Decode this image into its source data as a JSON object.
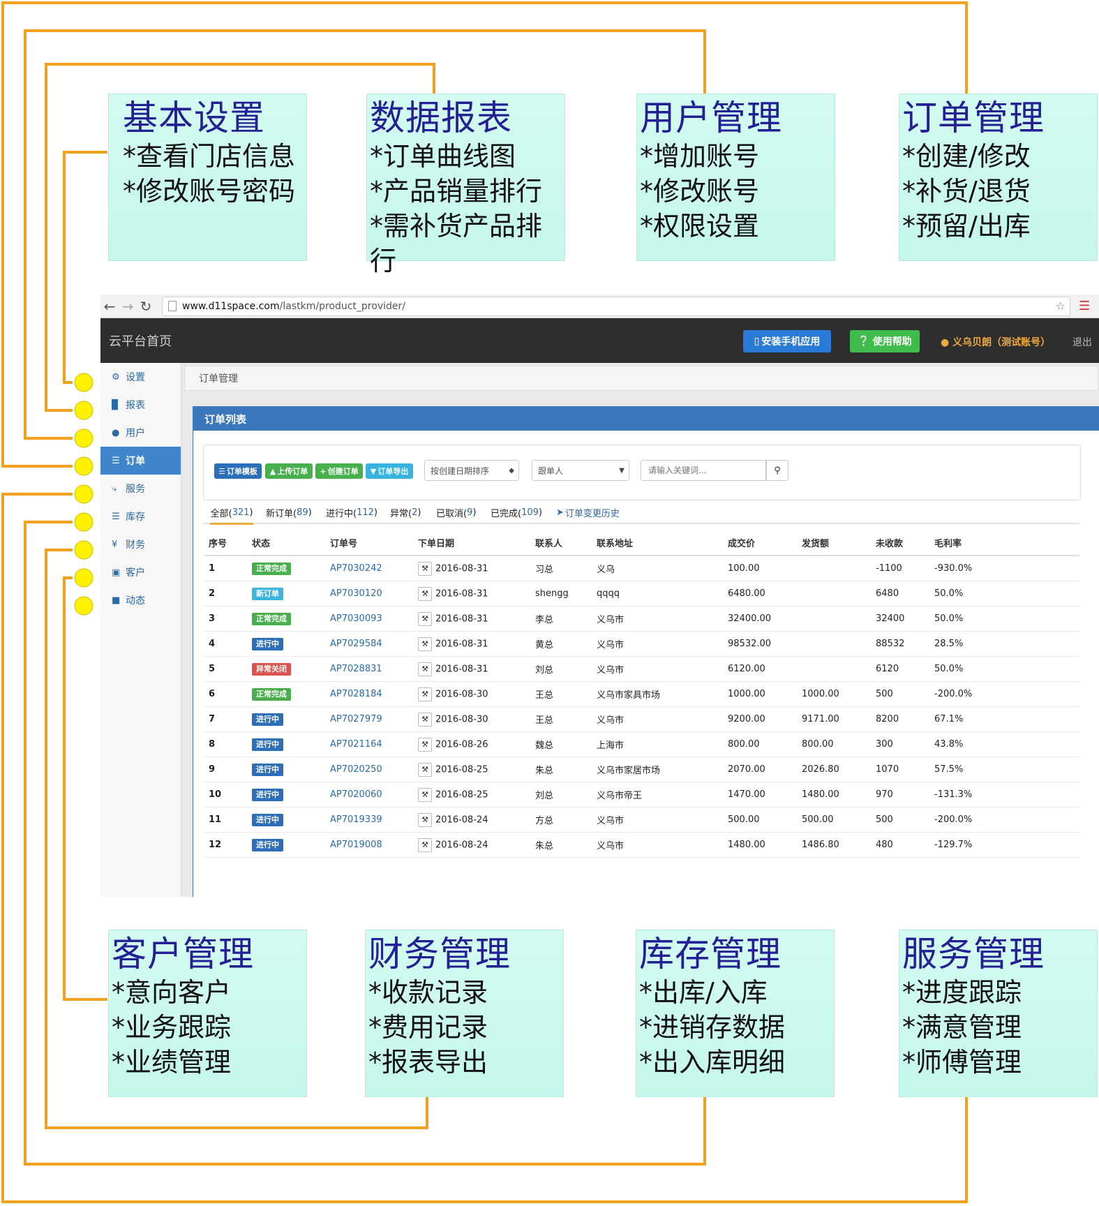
{
  "callouts_top": [
    {
      "title": "基本设置",
      "items": [
        "*查看门店信息",
        "*修改账号密码"
      ]
    },
    {
      "title": "数据报表",
      "items": [
        "*订单曲线图",
        "*产品销量排行",
        "*需补货产品排行"
      ]
    },
    {
      "title": "用户管理",
      "items": [
        "*增加账号",
        "*修改账号",
        "*权限设置"
      ]
    },
    {
      "title": "订单管理",
      "items": [
        "*创建/修改",
        "*补货/退货",
        "*预留/出库"
      ]
    }
  ],
  "callouts_bottom": [
    {
      "title": "客户管理",
      "items": [
        "*意向客户",
        "*业务跟踪",
        "*业绩管理"
      ]
    },
    {
      "title": "财务管理",
      "items": [
        "*收款记录",
        "*费用记录",
        "*报表导出"
      ]
    },
    {
      "title": "库存管理",
      "items": [
        "*出库/入库",
        "*进销存数据",
        "*出入库明细"
      ]
    },
    {
      "title": "服务管理",
      "items": [
        "*进度跟踪",
        "*满意管理",
        "*师傅管理"
      ]
    }
  ],
  "browser": {
    "url_host": "www.d11space.com",
    "url_path": "/lastkm/product_provider/"
  },
  "header": {
    "brand": "云平台首页",
    "install_app": "安装手机应用",
    "help": "使用帮助",
    "user": "义乌贝朗（测试账号）",
    "logout": "退出"
  },
  "sidebar": {
    "items": [
      {
        "label": "设置",
        "icon": "gear-icon"
      },
      {
        "label": "报表",
        "icon": "bar-chart-icon"
      },
      {
        "label": "用户",
        "icon": "user-icon"
      },
      {
        "label": "订单",
        "icon": "list-icon",
        "active": true
      },
      {
        "label": "服务",
        "icon": "wrench-icon"
      },
      {
        "label": "库存",
        "icon": "barcode-icon"
      },
      {
        "label": "财务",
        "icon": "yen-icon"
      },
      {
        "label": "客户",
        "icon": "briefcase-icon"
      },
      {
        "label": "动态",
        "icon": "comment-icon"
      }
    ]
  },
  "breadcrumb": "订单管理",
  "panel_title": "订单列表",
  "toolbar": {
    "template": "订单模板",
    "upload": "上传订单",
    "create": "创建订单",
    "export": "订单导出",
    "sort_select": "按创建日期排序",
    "follower_select": "跟单人",
    "search_placeholder": "请输入关键词..."
  },
  "tabs": [
    {
      "label": "全部(",
      "count": "321",
      "suffix": ")"
    },
    {
      "label": "新订单(",
      "count": "89",
      "suffix": ")"
    },
    {
      "label": "进行中(",
      "count": "112",
      "suffix": ")"
    },
    {
      "label": "异常(",
      "count": "2",
      "suffix": ")"
    },
    {
      "label": "已取消(",
      "count": "9",
      "suffix": ")"
    },
    {
      "label": "已完成(",
      "count": "109",
      "suffix": ")"
    }
  ],
  "history_link": "订单变更历史",
  "table": {
    "headers": [
      "序号",
      "状态",
      "订单号",
      "下单日期",
      "联系人",
      "联系地址",
      "成交价",
      "发货额",
      "未收款",
      "毛利率"
    ],
    "rows": [
      {
        "no": "1",
        "status": "正常完成",
        "status_color": "#47b04c",
        "order": "AP7030242",
        "date": "2016-08-31",
        "contact": "习总",
        "addr": "义乌",
        "price": "100.00",
        "shipped": "",
        "unpaid": "-1100",
        "margin": "-930.0%"
      },
      {
        "no": "2",
        "status": "新订单",
        "status_color": "#3cb6e0",
        "order": "AP7030120",
        "date": "2016-08-31",
        "contact": "shengg",
        "addr": "qqqq",
        "price": "6480.00",
        "shipped": "",
        "unpaid": "6480",
        "margin": "50.0%"
      },
      {
        "no": "3",
        "status": "正常完成",
        "status_color": "#47b04c",
        "order": "AP7030093",
        "date": "2016-08-31",
        "contact": "李总",
        "addr": "义乌市",
        "price": "32400.00",
        "shipped": "",
        "unpaid": "32400",
        "margin": "50.0%"
      },
      {
        "no": "4",
        "status": "进行中",
        "status_color": "#2b6fba",
        "order": "AP7029584",
        "date": "2016-08-31",
        "contact": "黄总",
        "addr": "义乌市",
        "price": "98532.00",
        "shipped": "",
        "unpaid": "88532",
        "margin": "28.5%"
      },
      {
        "no": "5",
        "status": "异常关闭",
        "status_color": "#d9534f",
        "order": "AP7028831",
        "date": "2016-08-31",
        "contact": "刘总",
        "addr": "义乌市",
        "price": "6120.00",
        "shipped": "",
        "unpaid": "6120",
        "margin": "50.0%"
      },
      {
        "no": "6",
        "status": "正常完成",
        "status_color": "#47b04c",
        "order": "AP7028184",
        "date": "2016-08-30",
        "contact": "王总",
        "addr": "义乌市家具市场",
        "price": "1000.00",
        "shipped": "1000.00",
        "unpaid": "500",
        "margin": "-200.0%"
      },
      {
        "no": "7",
        "status": "进行中",
        "status_color": "#2b6fba",
        "order": "AP7027979",
        "date": "2016-08-30",
        "contact": "王总",
        "addr": "义乌市",
        "price": "9200.00",
        "shipped": "9171.00",
        "unpaid": "8200",
        "margin": "67.1%"
      },
      {
        "no": "8",
        "status": "进行中",
        "status_color": "#2b6fba",
        "order": "AP7021164",
        "date": "2016-08-26",
        "contact": "魏总",
        "addr": "上海市",
        "price": "800.00",
        "shipped": "800.00",
        "unpaid": "300",
        "margin": "43.8%"
      },
      {
        "no": "9",
        "status": "进行中",
        "status_color": "#2b6fba",
        "order": "AP7020250",
        "date": "2016-08-25",
        "contact": "朱总",
        "addr": "义乌市家居市场",
        "price": "2070.00",
        "shipped": "2026.80",
        "unpaid": "1070",
        "margin": "57.5%"
      },
      {
        "no": "10",
        "status": "进行中",
        "status_color": "#2b6fba",
        "order": "AP7020060",
        "date": "2016-08-25",
        "contact": "刘总",
        "addr": "义乌市帝王",
        "price": "1470.00",
        "shipped": "1480.00",
        "unpaid": "970",
        "margin": "-131.3%"
      },
      {
        "no": "11",
        "status": "进行中",
        "status_color": "#2b6fba",
        "order": "AP7019339",
        "date": "2016-08-24",
        "contact": "方总",
        "addr": "义乌市",
        "price": "500.00",
        "shipped": "500.00",
        "unpaid": "500",
        "margin": "-200.0%"
      },
      {
        "no": "12",
        "status": "进行中",
        "status_color": "#2b6fba",
        "order": "AP7019008",
        "date": "2016-08-24",
        "contact": "朱总",
        "addr": "义乌市",
        "price": "1480.00",
        "shipped": "1486.80",
        "unpaid": "480",
        "margin": "-129.7%"
      }
    ]
  },
  "colors": {
    "connector": "#f0a21e",
    "dot": "#fff200",
    "callout_bg": "#c8f8ee",
    "callout_title": "#231f95",
    "accent": "#3a78bd"
  }
}
